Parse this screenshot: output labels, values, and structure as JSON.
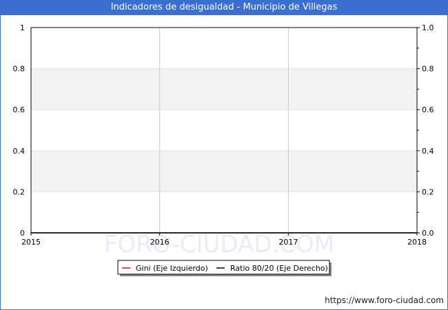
{
  "title": "Indicadores de desigualdad - Municipio de Villegas",
  "watermark": "FORO-CIUDAD.COM",
  "footer_url": "https://www.foro-ciudad.com",
  "colors": {
    "header": "#3a6fd0",
    "gini": "#ff0000",
    "ratio": "#000000",
    "band": "#f2f2f2",
    "grid": "#cccccc"
  },
  "chart_data": {
    "type": "line",
    "title": "Indicadores de desigualdad - Municipio de Villegas",
    "xlim": [
      2015,
      2018
    ],
    "x_ticks": [
      "2015",
      "2016",
      "2017",
      "2018"
    ],
    "y_left": {
      "lim": [
        0,
        1
      ],
      "ticks": [
        "0",
        "0.2",
        "0.4",
        "0.6",
        "0.8",
        "1"
      ]
    },
    "y_right": {
      "lim": [
        0,
        1
      ],
      "ticks": [
        "0.0",
        "0.2",
        "0.4",
        "0.6",
        "0.8",
        "1.0"
      ]
    },
    "series": [
      {
        "name": "Gini (Eje Izquierdo)",
        "axis": "left",
        "color": "#ff0000",
        "x": [
          2015,
          2018
        ],
        "y": [
          0,
          0
        ]
      },
      {
        "name": "Ratio 80/20 (Eje Derecho)",
        "axis": "right",
        "color": "#000000",
        "x": [
          2015,
          2018
        ],
        "y": [
          0,
          0
        ]
      }
    ],
    "grid": true,
    "legend": "bottom-center"
  }
}
